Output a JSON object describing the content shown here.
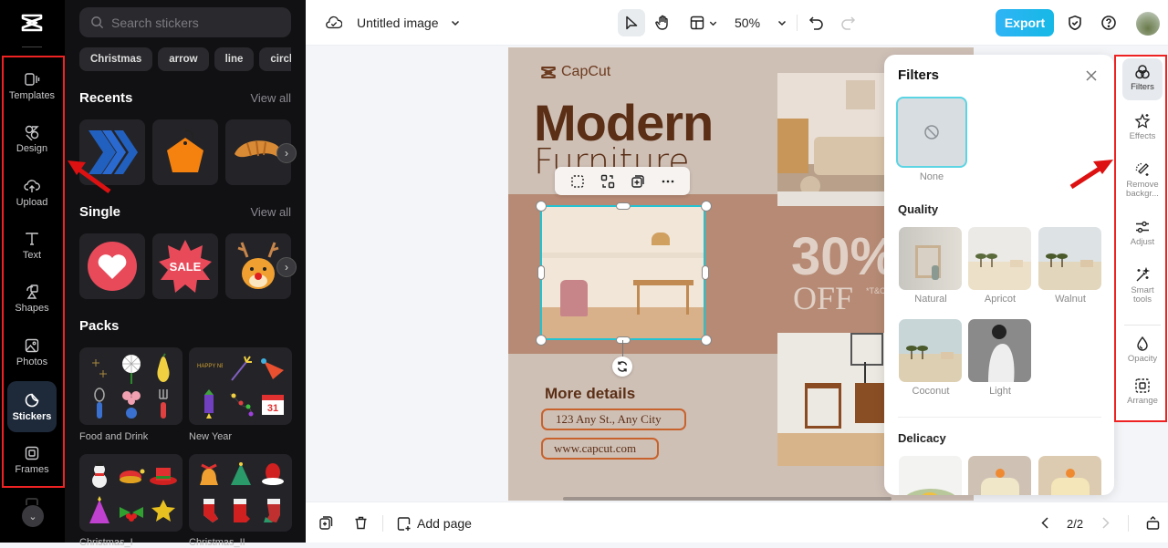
{
  "rail": {
    "items": [
      {
        "label": "Templates",
        "icon": "templates-icon"
      },
      {
        "label": "Design",
        "icon": "design-icon"
      },
      {
        "label": "Upload",
        "icon": "upload-icon"
      },
      {
        "label": "Text",
        "icon": "text-icon"
      },
      {
        "label": "Shapes",
        "icon": "shapes-icon"
      },
      {
        "label": "Photos",
        "icon": "photos-icon"
      },
      {
        "label": "Stickers",
        "icon": "stickers-icon",
        "active": true
      },
      {
        "label": "Frames",
        "icon": "frames-icon"
      }
    ]
  },
  "stickers_panel": {
    "search_placeholder": "Search stickers",
    "chips": [
      "Christmas",
      "arrow",
      "line",
      "circle"
    ],
    "recents": {
      "title": "Recents",
      "view_all": "View all",
      "items": [
        "blue-chevrons-sticker",
        "orange-tag-sticker",
        "croissant-sticker"
      ]
    },
    "single": {
      "title": "Single",
      "view_all": "View all",
      "items": [
        "heart-sticker",
        "sale-badge-sticker",
        "reindeer-sticker"
      ],
      "sale_text": "SALE"
    },
    "packs": {
      "title": "Packs",
      "items": [
        {
          "label": "Food and Drink"
        },
        {
          "label": "New Year"
        },
        {
          "label": "Christmas_I"
        },
        {
          "label": "Christmas_II"
        }
      ],
      "newyear_text": "HAPPY NEW YEAR",
      "calendar_text": "31"
    }
  },
  "topbar": {
    "doc_title": "Untitled image",
    "zoom": "50%",
    "export_label": "Export",
    "accent": "#16b8e6"
  },
  "design": {
    "brand": "CapCut",
    "headline": "Modern",
    "subheadline": "Furniture",
    "discount": "30%",
    "off": "OFF",
    "tnc": "*T&C",
    "details_title": "More details",
    "address": "123 Any St., Any City",
    "website": "www.capcut.com",
    "colors": {
      "bg": "#cfc0b6",
      "band": "#b68a74",
      "text": "#5b2f16",
      "pill": "#c8622c"
    }
  },
  "filters": {
    "title": "Filters",
    "none_label": "None",
    "sections": [
      {
        "title": "Quality",
        "items": [
          "Natural",
          "Apricot",
          "Walnut",
          "Coconut",
          "Light"
        ]
      },
      {
        "title": "Delicacy",
        "items": [
          "",
          "",
          ""
        ]
      }
    ]
  },
  "tools": {
    "items": [
      {
        "label": "Filters",
        "active": true
      },
      {
        "label": "Effects"
      },
      {
        "label": "Remove backgr..."
      },
      {
        "label": "Adjust"
      },
      {
        "label": "Smart tools"
      },
      {
        "label": "Opacity"
      },
      {
        "label": "Arrange"
      }
    ]
  },
  "bottombar": {
    "add_page": "Add page",
    "page_indicator": "2/2"
  }
}
